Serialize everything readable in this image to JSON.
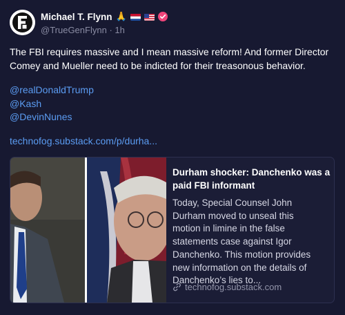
{
  "author": {
    "name": "Michael T. Flynn",
    "emoji": "🙏",
    "handle": "@TrueGenFlynn",
    "separator": "·",
    "time": "1h"
  },
  "post": {
    "text_lines": [
      "The FBI requires massive and I mean massive reform! And former Director",
      "Comey and Mueller need to be indicted for their treasonous behavior."
    ],
    "mentions": [
      "@realDonaldTrump",
      "@Kash",
      "@DevinNunes"
    ],
    "url": "technofog.substack.com/p/durha..."
  },
  "link_card": {
    "title_lines": [
      "Durham shocker: Danchenko was a",
      "paid FBI informant"
    ],
    "description_lines": [
      "Today, Special Counsel John",
      "Durham moved to unseal this",
      "motion in limine in the false",
      "statements case against Igor",
      "Danchenko. This motion provides",
      "new information on the details of",
      "Danchenko’s lies to..."
    ],
    "domain": "technofog.substack.com"
  },
  "colors": {
    "background": "#171931",
    "link": "#5b9cf2",
    "muted": "#8a8ca3",
    "verified_badge": "#f0457a"
  },
  "icons": {
    "avatar": "tgf-logo",
    "flag_1": "netherlands-flag",
    "flag_2": "usa-flag",
    "badge": "verified-check-icon",
    "card_domain": "link-icon"
  }
}
